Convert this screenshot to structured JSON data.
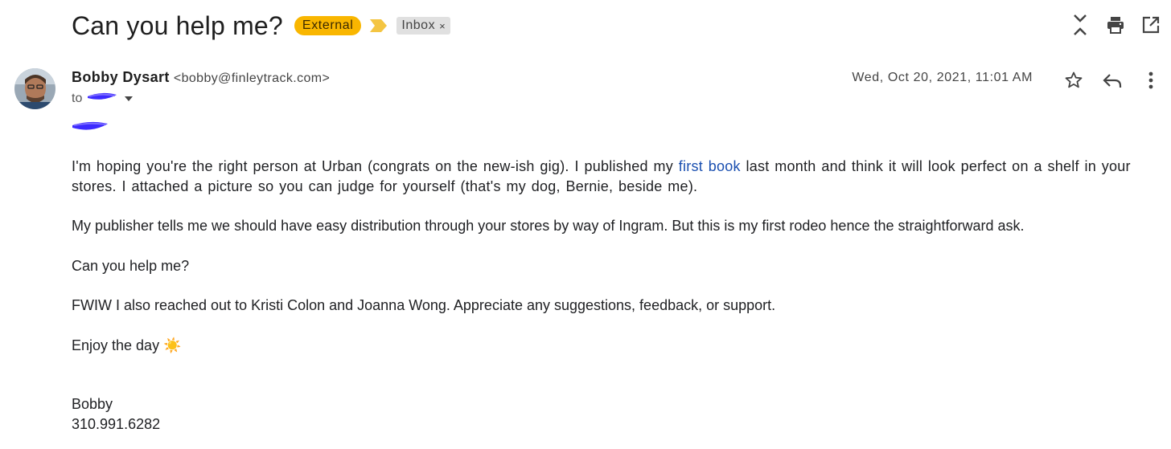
{
  "header": {
    "subject": "Can you help me?",
    "badge_external": "External",
    "label_inbox": "Inbox",
    "label_remove": "×"
  },
  "top_actions": [
    "collapse-icon",
    "print-icon",
    "open-new-window-icon"
  ],
  "message": {
    "sender_name": "Bobby Dysart",
    "sender_email": "<bobby@finleytrack.com>",
    "to_prefix": "to",
    "date": "Wed, Oct 20, 2021, 11:01 AM",
    "actions": [
      "star-icon",
      "reply-icon",
      "more-vert-icon"
    ]
  },
  "body": {
    "p1_before": "I'm hoping you're the right person at Urban (congrats on the new-ish gig). I published my ",
    "p1_link": "first book",
    "p1_after": " last month and think it will look perfect on a shelf in your stores. I attached a picture so you can judge for yourself (that's my dog, Bernie, beside me).",
    "p2": "My publisher tells me we should have easy distribution through your stores by way of Ingram. But this is my first rodeo hence the straightforward ask.",
    "p3": "Can you help me?",
    "p4": "FWIW I also reached out to Kristi Colon and Joanna Wong. Appreciate any suggestions, feedback, or support.",
    "p5": "Enjoy the day",
    "p5_emoji": "☀️"
  },
  "signature": {
    "name": "Bobby",
    "phone": "310.991.6282"
  },
  "colors": {
    "external_badge": "#f9b600",
    "importance_marker": "#f4c542",
    "link": "#1a4fb0",
    "redaction": "#3d2bff"
  }
}
